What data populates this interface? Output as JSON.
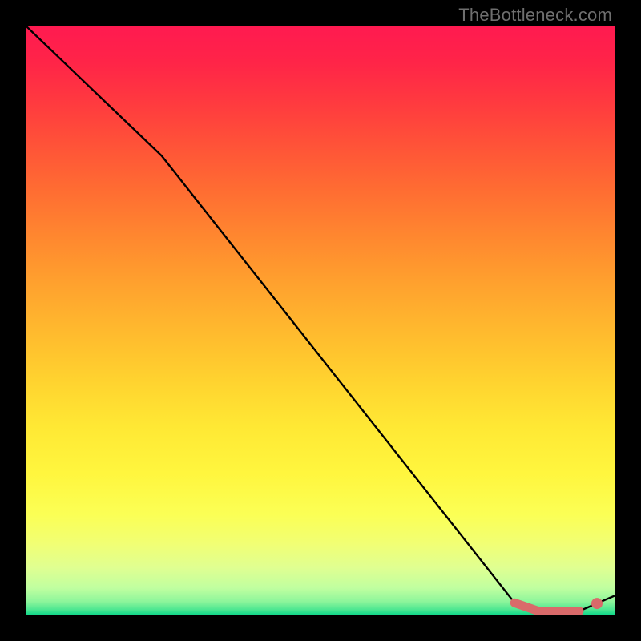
{
  "watermark": "TheBottleneck.com",
  "colors": {
    "frame": "#000000",
    "gradient_stops": [
      {
        "offset": 0.0,
        "color": "#ff1a50"
      },
      {
        "offset": 0.06,
        "color": "#ff2448"
      },
      {
        "offset": 0.13,
        "color": "#ff3a3f"
      },
      {
        "offset": 0.2,
        "color": "#ff5238"
      },
      {
        "offset": 0.28,
        "color": "#ff6d32"
      },
      {
        "offset": 0.36,
        "color": "#ff882f"
      },
      {
        "offset": 0.44,
        "color": "#ffa22e"
      },
      {
        "offset": 0.52,
        "color": "#ffba2e"
      },
      {
        "offset": 0.6,
        "color": "#ffd22f"
      },
      {
        "offset": 0.68,
        "color": "#ffe834"
      },
      {
        "offset": 0.76,
        "color": "#fff63e"
      },
      {
        "offset": 0.83,
        "color": "#fbff55"
      },
      {
        "offset": 0.88,
        "color": "#f1ff74"
      },
      {
        "offset": 0.92,
        "color": "#e0ff91"
      },
      {
        "offset": 0.955,
        "color": "#c0ffa0"
      },
      {
        "offset": 0.978,
        "color": "#8cf59b"
      },
      {
        "offset": 0.992,
        "color": "#4ae691"
      },
      {
        "offset": 1.0,
        "color": "#12d98a"
      }
    ],
    "curve": "#000000",
    "highlight_stroke": "#d96a6a",
    "highlight_dot": "#d96a6a"
  },
  "chart_data": {
    "type": "line",
    "title": "",
    "xlabel": "",
    "ylabel": "",
    "xlim": [
      0,
      100
    ],
    "ylim": [
      0,
      100
    ],
    "x": [
      0,
      23,
      83,
      87,
      94,
      100
    ],
    "values": [
      100,
      78,
      2.0,
      0.6,
      0.6,
      3.2
    ],
    "highlight_segment": {
      "x": [
        83,
        87,
        94
      ],
      "values": [
        2.0,
        0.6,
        0.6
      ]
    },
    "highlight_point": {
      "x": 97,
      "value": 1.9
    },
    "note": "Values estimated from pixel positions; x and y axes have no visible tick labels."
  }
}
